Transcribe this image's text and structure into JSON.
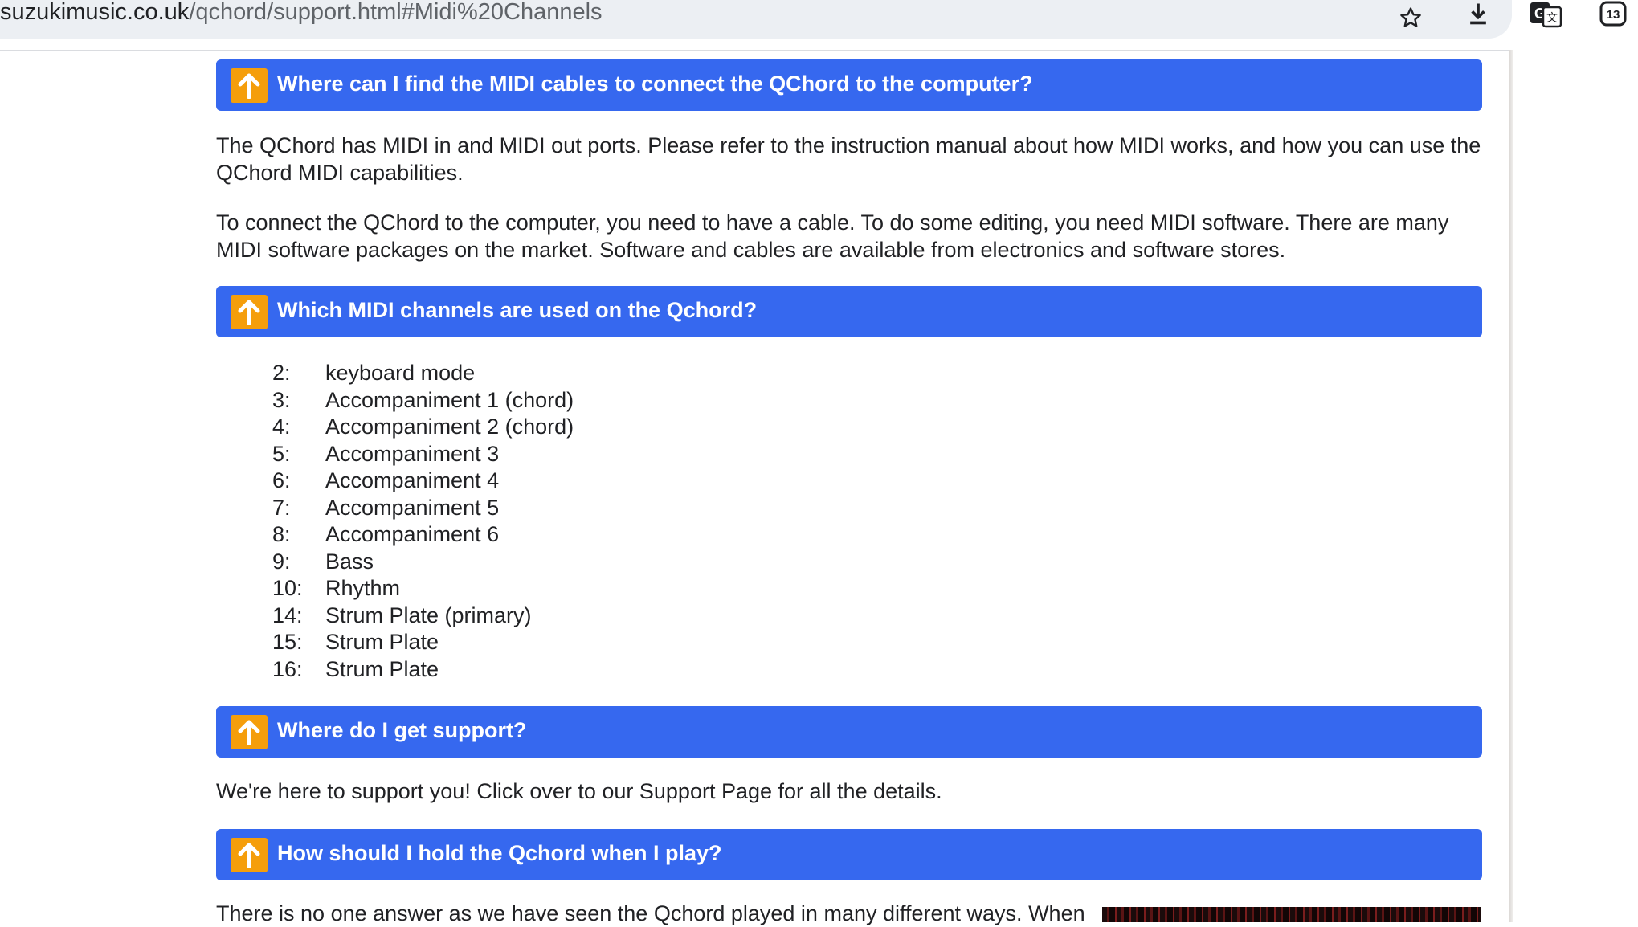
{
  "browser": {
    "url_host": "suzukimusic.co.uk",
    "url_path": "/qchord/support.html#Midi%20Channels",
    "icons": [
      "star-icon",
      "download-icon",
      "translate-icon",
      "tab-count-icon"
    ],
    "tab_count": "13"
  },
  "sections": [
    {
      "title": "Where can I find the MIDI cables to connect the QChord to the computer?",
      "paragraphs": [
        "The QChord has MIDI in and MIDI out ports. Please refer to the instruction manual about how MIDI works, and how you can use the QChord MIDI capabilities.",
        "To connect the QChord to the computer, you need to have a cable. To do some editing, you need MIDI software. There are many MIDI software packages on the market. Software and cables are available from electronics and software stores."
      ]
    },
    {
      "title": "Which MIDI channels are used on the Qchord?",
      "channels": [
        {
          "num": "2:",
          "name": "keyboard mode"
        },
        {
          "num": "3:",
          "name": "Accompaniment 1 (chord)"
        },
        {
          "num": "4:",
          "name": "Accompaniment 2 (chord)"
        },
        {
          "num": "5:",
          "name": "Accompaniment 3"
        },
        {
          "num": "6:",
          "name": "Accompaniment 4"
        },
        {
          "num": "7:",
          "name": "Accompaniment 5"
        },
        {
          "num": "8:",
          "name": "Accompaniment 6"
        },
        {
          "num": "9:",
          "name": "Bass"
        },
        {
          "num": "10:",
          "name": "Rhythm"
        },
        {
          "num": "14:",
          "name": "Strum Plate (primary)"
        },
        {
          "num": "15:",
          "name": "Strum Plate"
        },
        {
          "num": "16:",
          "name": "Strum Plate"
        }
      ]
    },
    {
      "title": "Where do I get support?",
      "paragraphs": [
        "We're here to support you! Click over to our Support Page for all the details."
      ]
    },
    {
      "title": "How should I hold the Qchord when I play?",
      "paragraphs": [
        "There is no one answer as we have seen the Qchord played in many different ways. When"
      ]
    }
  ],
  "colors": {
    "header_blue": "#3668ef",
    "up_arrow_orange": "#f59e0b"
  }
}
